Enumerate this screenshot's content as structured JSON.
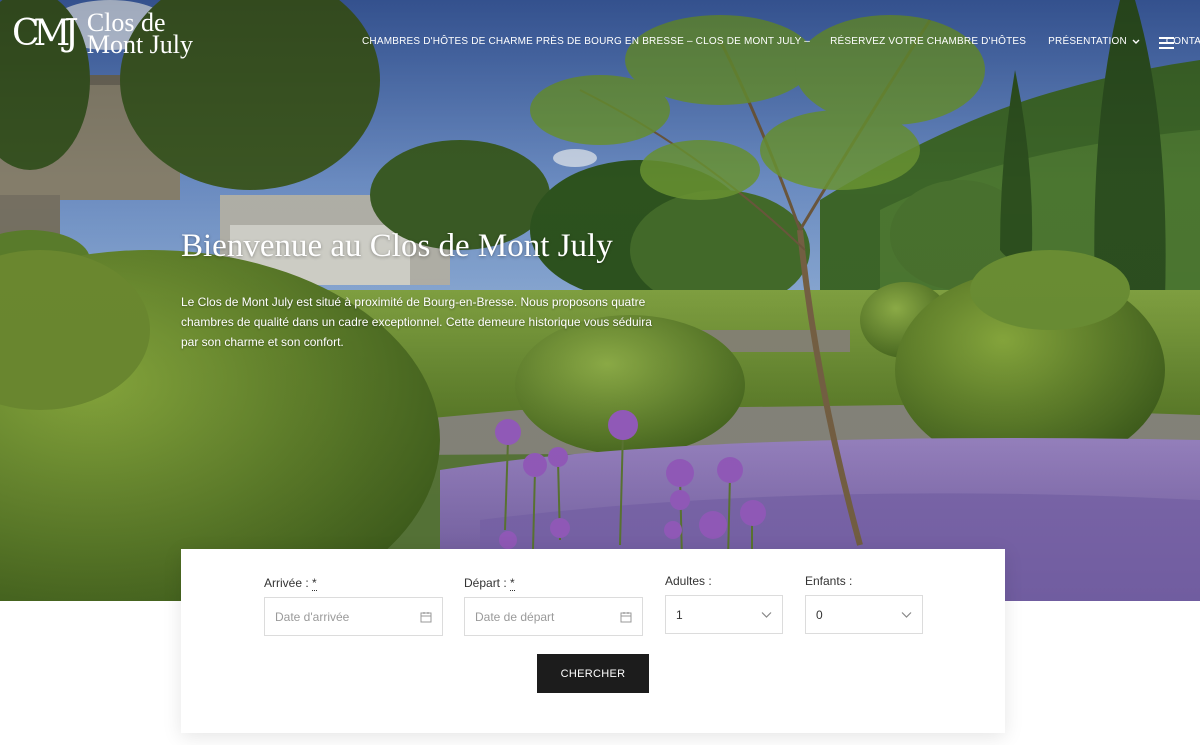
{
  "brand": {
    "monogram": "CMJ",
    "name_line1": "Clos de",
    "name_line2": "Mont July"
  },
  "nav": {
    "items": [
      {
        "label": "CHAMBRES D'HÔTES DE CHARME PRÈS DE BOURG EN BRESSE – CLOS DE MONT JULY –"
      },
      {
        "label": "RÉSERVEZ VOTRE CHAMBRE D'HÔTES"
      },
      {
        "label": "PRÉSENTATION",
        "icon": "chevron-down-icon"
      },
      {
        "label": "CONTACT"
      }
    ],
    "menu_icon": "hamburger-menu-icon"
  },
  "hero": {
    "title": "Bienvenue au Clos de Mont July",
    "description": "Le Clos de Mont July est situé à proximité de Bourg-en-Bresse. Nous proposons quatre chambres de qualité dans un cadre exceptionnel. Cette demeure historique vous séduira par son charme et son confort."
  },
  "booking": {
    "arrival": {
      "label": "Arrivée :",
      "required_mark": "*",
      "placeholder": "Date d'arrivée",
      "icon": "calendar-icon"
    },
    "departure": {
      "label": "Départ :",
      "required_mark": "*",
      "placeholder": "Date de départ",
      "icon": "calendar-icon"
    },
    "adults": {
      "label": "Adultes :",
      "value": "1",
      "icon": "chevron-down-icon"
    },
    "children": {
      "label": "Enfants :",
      "value": "0",
      "icon": "chevron-down-icon"
    },
    "submit_label": "CHERCHER"
  },
  "colors": {
    "button_bg": "#1c1c1c",
    "nav_text": "#ffffff",
    "sky": "#4a70b5",
    "grass": "#7a9a3c",
    "lavender": "#8e6fc0"
  }
}
